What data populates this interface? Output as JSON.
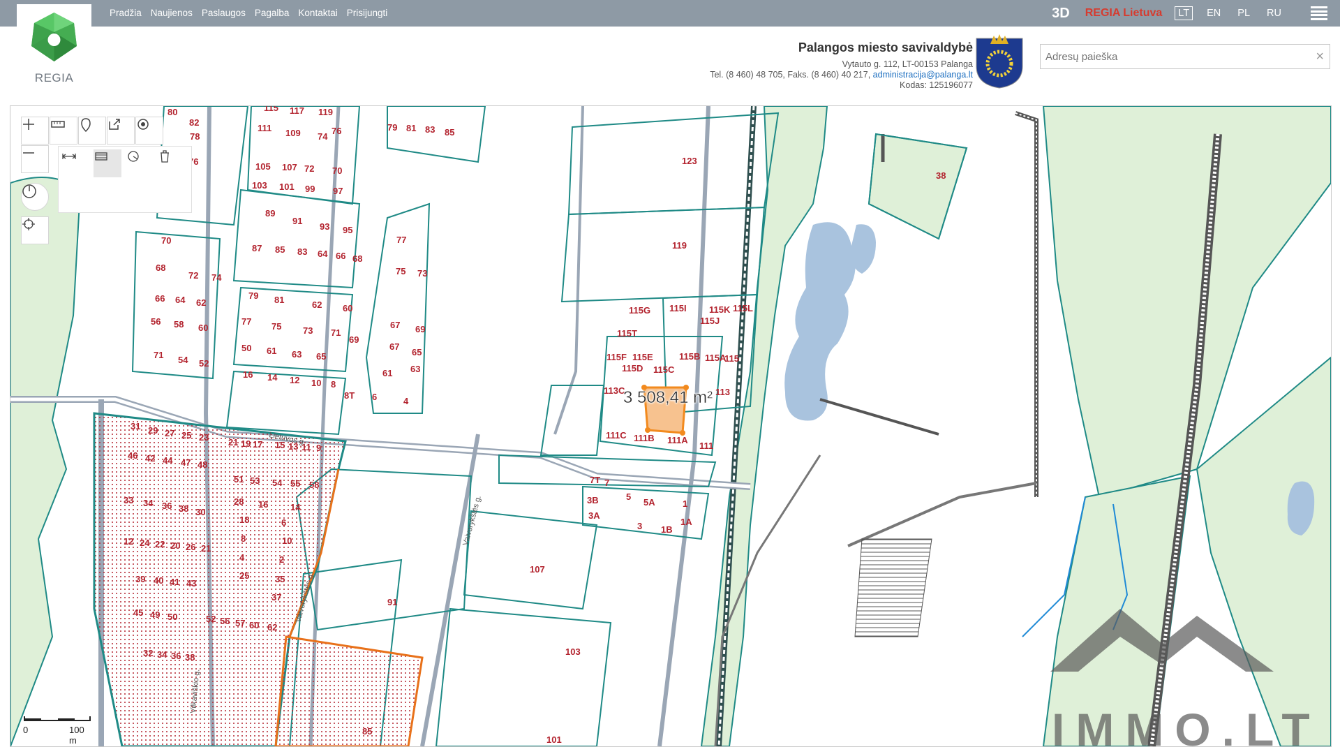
{
  "nav": {
    "items": [
      "Pradžia",
      "Naujienos",
      "Paslaugos",
      "Pagalba",
      "Kontaktai",
      "Prisijungti"
    ]
  },
  "top_right": {
    "btn_3d": "3D",
    "regia_lietuva": "REGIA Lietuva",
    "languages": [
      "LT",
      "EN",
      "PL",
      "RU"
    ],
    "active_language": "LT"
  },
  "logo": {
    "text": "REGIA"
  },
  "municipality": {
    "name": "Palangos miesto savivaldybė",
    "address": "Vytauto g. 112, LT-00153 Palanga",
    "phone": "Tel. (8 460) 48 705, Faks. (8 460) 40 217,",
    "email": "administracija@palanga.lt",
    "code": "Kodas: 125196077"
  },
  "search": {
    "placeholder": "Adresų paieška",
    "value": "",
    "clear": "×"
  },
  "map": {
    "measurement": "3 508,41 m²",
    "scale": {
      "zero": "0",
      "distance": "100 m"
    },
    "watermark": "IMMO.LT",
    "parcel_labels": [
      "80",
      "82",
      "78",
      "76",
      "115",
      "117",
      "119",
      "111",
      "109",
      "74",
      "76",
      "79",
      "81",
      "83",
      "85",
      "105",
      "107",
      "72",
      "70",
      "103",
      "101",
      "99",
      "97",
      "89",
      "91",
      "93",
      "95",
      "87",
      "85",
      "83",
      "64",
      "66",
      "68",
      "123",
      "119",
      "70",
      "68",
      "72",
      "74",
      "77",
      "75",
      "73",
      "66",
      "64",
      "62",
      "79",
      "81",
      "62",
      "60",
      "56",
      "58",
      "60",
      "77",
      "75",
      "73",
      "71",
      "69",
      "71",
      "54",
      "52",
      "50",
      "61",
      "63",
      "65",
      "67",
      "69",
      "67",
      "65",
      "16",
      "14",
      "12",
      "10",
      "8",
      "61",
      "63",
      "6",
      "4",
      "8T",
      "115G",
      "115I",
      "115K",
      "115L",
      "115J",
      "115T",
      "115F",
      "115E",
      "115D",
      "115C",
      "115B",
      "115A",
      "115",
      "113C",
      "113",
      "111C",
      "111B",
      "111A",
      "111",
      "7T",
      "7",
      "5",
      "3B",
      "5A",
      "1",
      "3A",
      "1A",
      "3",
      "1B",
      "107",
      "103",
      "101",
      "91",
      "85",
      "38",
      "31",
      "29",
      "27",
      "25",
      "23",
      "21",
      "19",
      "17",
      "15",
      "13",
      "11",
      "9",
      "46",
      "42",
      "44",
      "47",
      "48",
      "51",
      "53",
      "54",
      "55",
      "58",
      "33",
      "34",
      "36",
      "38",
      "30",
      "12",
      "24",
      "22",
      "20",
      "26",
      "21",
      "28",
      "16",
      "14",
      "18",
      "6",
      "8",
      "10",
      "4",
      "2",
      "25",
      "35",
      "37",
      "39",
      "40",
      "41",
      "43",
      "45",
      "49",
      "50",
      "52",
      "56",
      "57",
      "60",
      "62",
      "32",
      "34",
      "36",
      "38"
    ],
    "street_labels": [
      "Lietuvos g.",
      "Vaivorykštės g.",
      "Vilkaviškio g.",
      "Vaivorykštės g."
    ]
  },
  "colors": {
    "topbar": "#8e9aa5",
    "parcel_line": "#1f8a86",
    "parcel_label": "#b3242f",
    "selected_fill": "#f7c28f",
    "selected_stroke": "#f28a1e",
    "highlight_orange": "#e8711a",
    "water": "#a9c3de",
    "greenery": "#dff0d8"
  }
}
